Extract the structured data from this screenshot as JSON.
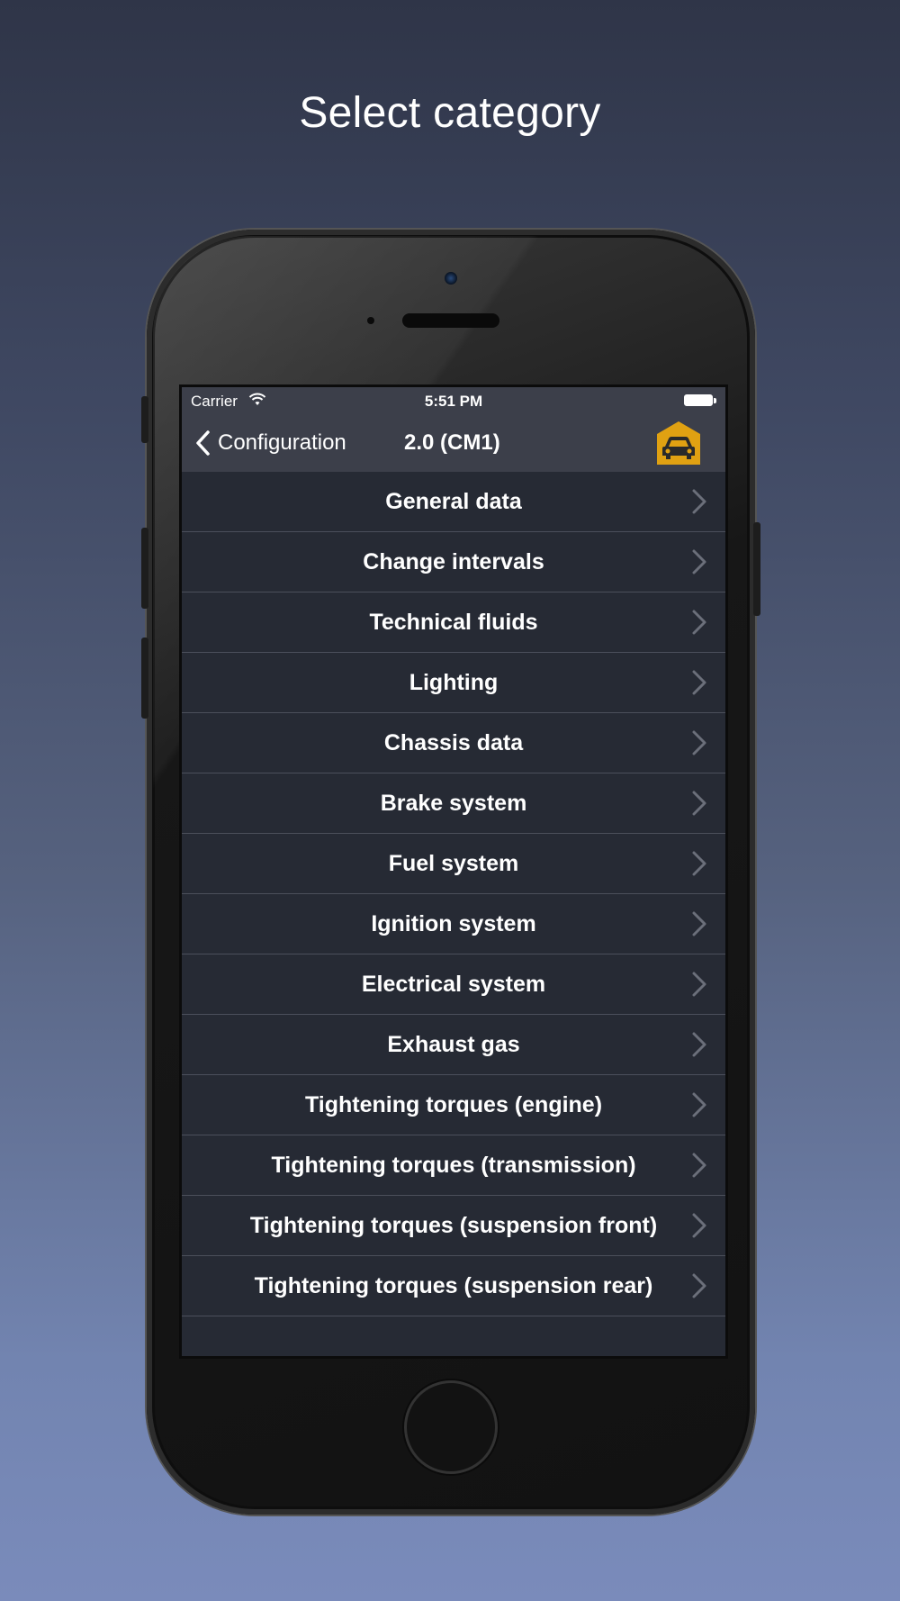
{
  "headline": "Select category",
  "status_bar": {
    "carrier": "Carrier",
    "time": "5:51 PM",
    "icons": [
      "wifi-icon",
      "battery-icon"
    ]
  },
  "nav": {
    "back_label": "Configuration",
    "title": "2.0 (CM1)",
    "garage_icon": "garage-car-icon",
    "garage_color": "#e0a112"
  },
  "categories": [
    {
      "label": "General data"
    },
    {
      "label": "Change intervals"
    },
    {
      "label": "Technical fluids"
    },
    {
      "label": "Lighting"
    },
    {
      "label": "Chassis data"
    },
    {
      "label": "Brake system"
    },
    {
      "label": "Fuel system"
    },
    {
      "label": "Ignition system"
    },
    {
      "label": "Electrical system"
    },
    {
      "label": "Exhaust gas"
    },
    {
      "label": "Tightening torques (engine)"
    },
    {
      "label": "Tightening torques (transmission)"
    },
    {
      "label": "Tightening torques (suspension front)"
    },
    {
      "label": "Tightening torques (suspension rear)"
    }
  ],
  "colors": {
    "list_background": "#262a34",
    "bar_background": "#3c3f4a",
    "separator": "#4b4f5b",
    "chevron": "#6b6f7a"
  }
}
